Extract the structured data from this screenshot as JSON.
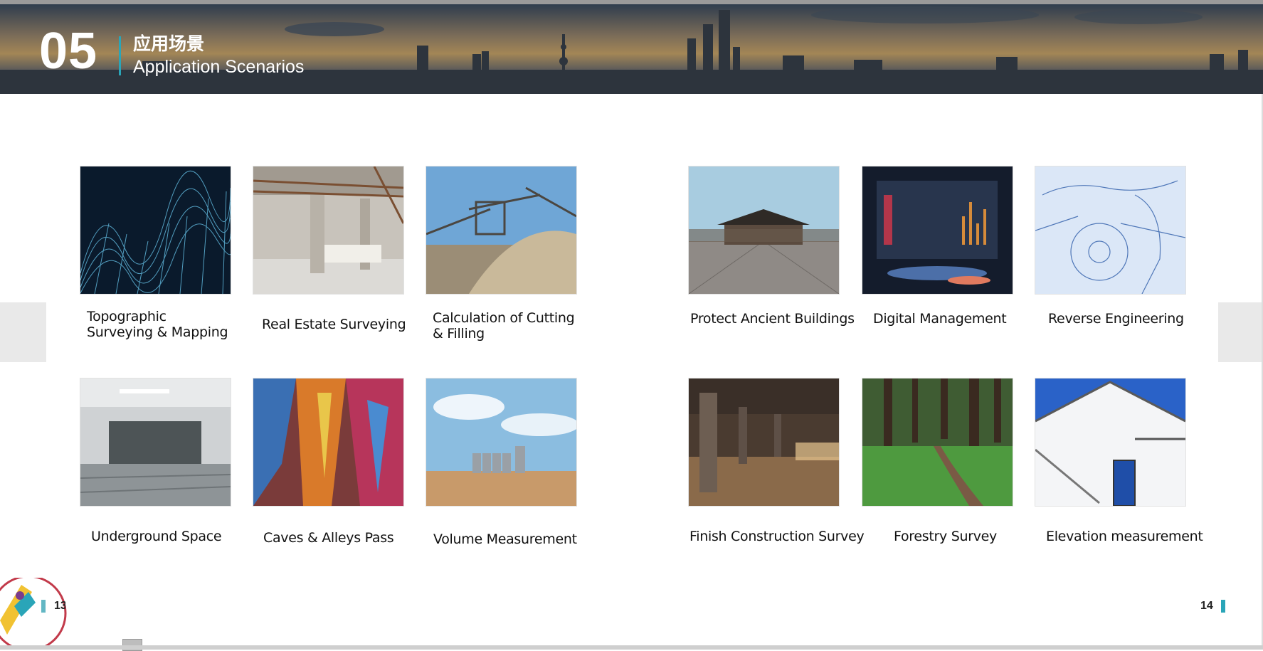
{
  "header": {
    "section_number": "05",
    "title_cn": "应用场景",
    "title_en": "Application Scenarios"
  },
  "scenarios": [
    {
      "label": "Topographic Surveying & Mapping",
      "image": "wireframe-terrain-image"
    },
    {
      "label": "Real Estate Surveying",
      "image": "empty-building-interior-image"
    },
    {
      "label": "Calculation of Cutting & Filling",
      "image": "quarry-sand-pile-image"
    },
    {
      "label": "Protect Ancient Buildings",
      "image": "ancient-palace-square-image"
    },
    {
      "label": "Digital Management",
      "image": "digital-data-room-image"
    },
    {
      "label": "Reverse Engineering",
      "image": "wireframe-car-interior-image"
    },
    {
      "label": "Underground Space",
      "image": "underground-parking-image"
    },
    {
      "label": "Caves & Alleys Pass",
      "image": "colorful-cave-image"
    },
    {
      "label": "Volume Measurement",
      "image": "grain-silo-field-image"
    },
    {
      "label": "Finish Construction Survey",
      "image": "concrete-structure-image"
    },
    {
      "label": "Forestry Survey",
      "image": "forest-path-image"
    },
    {
      "label": "Elevation measurement",
      "image": "white-building-facade-image"
    }
  ],
  "page_numbers": {
    "left": "13",
    "right": "14"
  },
  "colors": {
    "accent": "#2aa5b8",
    "text": "#111111"
  }
}
